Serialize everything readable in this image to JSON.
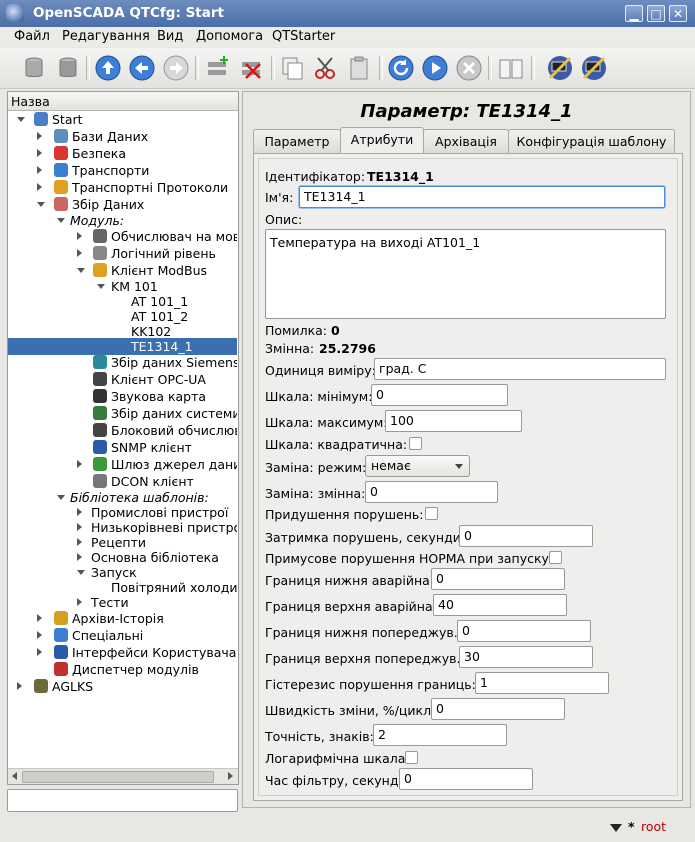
{
  "window": {
    "title": "OpenSCADA QTCfg: Start"
  },
  "menu": [
    "Файл",
    "Редагування",
    "Вид",
    "Допомога",
    "QTStarter"
  ],
  "tree": {
    "header": "Назва",
    "items": [
      {
        "label": "Start",
        "italic": false
      },
      {
        "label": "Бази Даних",
        "italic": false
      },
      {
        "label": "Безпека",
        "italic": false
      },
      {
        "label": "Транспорти",
        "italic": false
      },
      {
        "label": "Транспортні Протоколи",
        "italic": false
      },
      {
        "label": "Збір Даних",
        "italic": false
      },
      {
        "label": "Модуль:",
        "italic": true
      },
      {
        "label": "Обчислювач на мов",
        "italic": false
      },
      {
        "label": "Логічний рівень",
        "italic": false
      },
      {
        "label": "Клієнт ModBus",
        "italic": false
      },
      {
        "label": "KM 101",
        "italic": false
      },
      {
        "label": "AT 101_1",
        "italic": false
      },
      {
        "label": "AT 101_2",
        "italic": false
      },
      {
        "label": "KK102",
        "italic": false
      },
      {
        "label": "TE1314_1",
        "italic": false
      },
      {
        "label": "Збір даних Siemens",
        "italic": false
      },
      {
        "label": "Клієнт OPC-UA",
        "italic": false
      },
      {
        "label": "Звукова карта",
        "italic": false
      },
      {
        "label": "Збір даних системи",
        "italic": false
      },
      {
        "label": "Блоковий обчислюв",
        "italic": false
      },
      {
        "label": "SNMP клієнт",
        "italic": false
      },
      {
        "label": "Шлюз джерел дани",
        "italic": false
      },
      {
        "label": "DCON клієнт",
        "italic": false
      },
      {
        "label": "Бібліотека шаблонів:",
        "italic": true
      },
      {
        "label": "Промислові пристрої",
        "italic": false
      },
      {
        "label": "Низькорівневі пристрої",
        "italic": false
      },
      {
        "label": "Рецепти",
        "italic": false
      },
      {
        "label": "Основна бібліотека",
        "italic": false
      },
      {
        "label": "Запуск",
        "italic": false
      },
      {
        "label": "Повітряний холодил",
        "italic": false
      },
      {
        "label": "Тести",
        "italic": false
      },
      {
        "label": "Архіви-Історія",
        "italic": false
      },
      {
        "label": "Спеціальні",
        "italic": false
      },
      {
        "label": "Інтерфейси Користувача",
        "italic": false
      },
      {
        "label": "Диспетчер модулів",
        "italic": false
      },
      {
        "label": "AGLKS",
        "italic": false
      }
    ]
  },
  "page": {
    "title": "Параметр: TE1314_1",
    "tabs": [
      "Параметр",
      "Атрибути",
      "Архівація",
      "Конфігурація шаблону"
    ],
    "active_tab": "Атрибути"
  },
  "form": {
    "id_label": "Ідентифікатор:",
    "id_value": "TE1314_1",
    "name_label": "Ім'я:",
    "name_value": "TE1314_1",
    "desc_label": "Опис:",
    "desc_value": "Температура на виході AT101_1",
    "error_label": "Помилка:",
    "error_value": "0",
    "var_label": "Змінна:",
    "var_value": "25.2796",
    "unit_label": "Одиниця виміру:",
    "unit_value": "град. С",
    "min_label": "Шкала: мінімум:",
    "min_value": "0",
    "max_label": "Шкала: максимум:",
    "max_value": "100",
    "sq_label": "Шкала: квадратична:",
    "subst_mode_label": "Заміна: режим:",
    "subst_mode_value": "немає",
    "subst_var_label": "Заміна: змінна:",
    "subst_var_value": "0",
    "suppress_label": "Придушення порушень:",
    "delay_label": "Затримка порушень, секунди:",
    "delay_value": "0",
    "force_label": "Примусове порушення НОРМА при запуску:",
    "lo_alarm_label": "Границя нижня аварійна:",
    "lo_alarm_value": "0",
    "hi_alarm_label": "Границя верхня аварійна:",
    "hi_alarm_value": "40",
    "lo_warn_label": "Границя нижня попереджув.:",
    "lo_warn_value": "0",
    "hi_warn_label": "Границя верхня попереджув.:",
    "hi_warn_value": "30",
    "hyst_label": "Гістерезис порушення границь:",
    "hyst_value": "1",
    "speed_label": "Швидкість зміни, %/цикл:",
    "speed_value": "0",
    "prec_label": "Точність, знаків:",
    "prec_value": "2",
    "log_label": "Логарифмічна шкала:",
    "filter_label": "Час фільтру, секунд:",
    "filter_value": "0"
  },
  "status": {
    "marker": "*",
    "user": "root"
  },
  "colors": {
    "selection": "#3a6fb0",
    "titlebar": "#4a6ea8",
    "user": "#c00000"
  }
}
